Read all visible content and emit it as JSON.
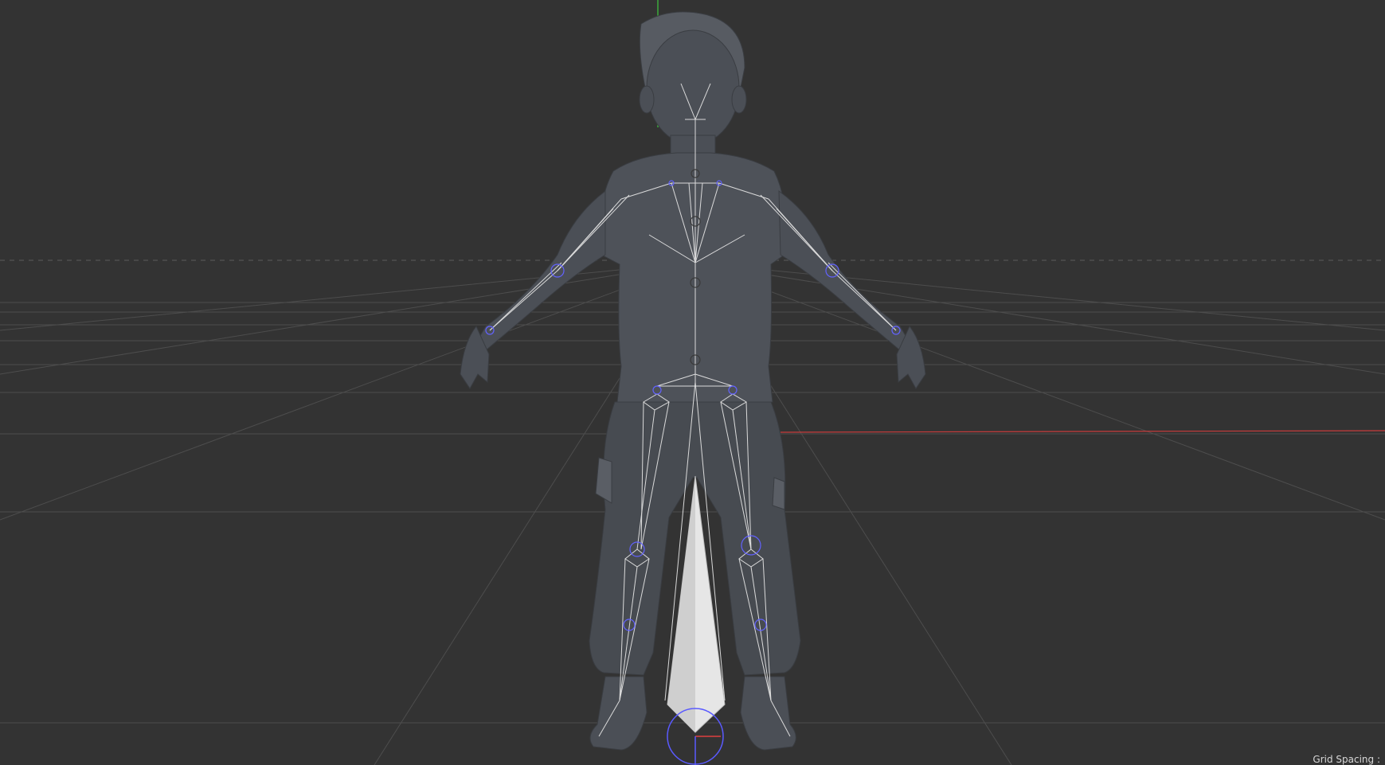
{
  "viewport": {
    "grid_spacing_label": "Grid Spacing :",
    "colors": {
      "background": "#333333",
      "grid": "#4a4a4a",
      "horizon": "#5a5a5a",
      "axis_x": "#c83c3c",
      "axis_y": "#3cc83c",
      "mesh": "#4b4f55",
      "bone": "#e0e0e0",
      "joint": "#5a5aff"
    },
    "icons": [
      "character-mesh-icon",
      "skeleton-rig-icon",
      "root-bone-icon",
      "transform-gizmo-icon"
    ]
  }
}
